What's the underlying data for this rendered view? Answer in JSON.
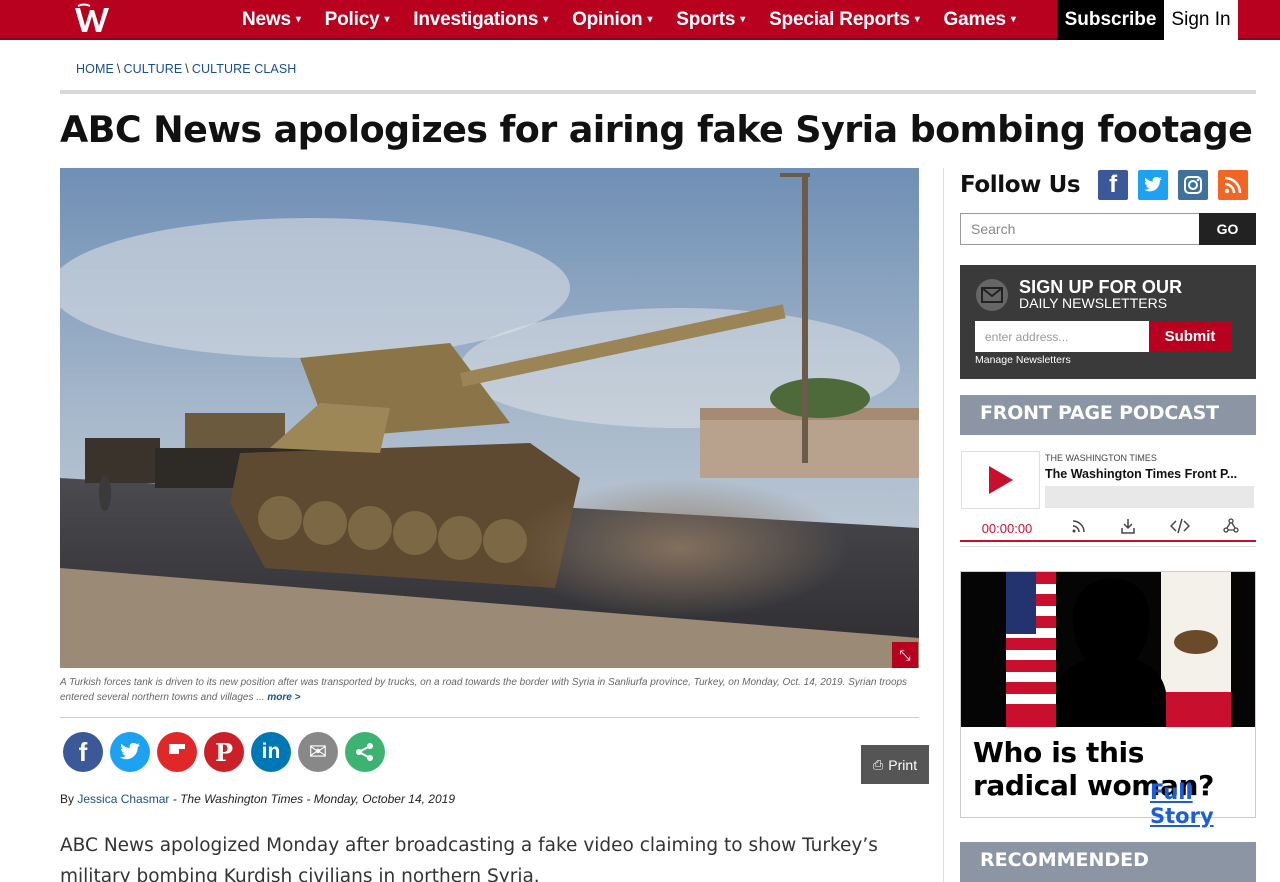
{
  "nav": {
    "logo_alt": "W",
    "items": [
      {
        "label": "News"
      },
      {
        "label": "Policy"
      },
      {
        "label": "Investigations"
      },
      {
        "label": "Opinion"
      },
      {
        "label": "Sports"
      },
      {
        "label": "Special Reports"
      },
      {
        "label": "Games"
      }
    ],
    "caret": "▾",
    "subscribe": "Subscribe",
    "signin": "Sign In"
  },
  "breadcrumb": {
    "items": [
      "HOME",
      "CULTURE",
      "CULTURE CLASH"
    ],
    "separator": "\\"
  },
  "article": {
    "headline": "ABC News apologizes for airing fake Syria bombing footage",
    "caption": "A Turkish forces tank is driven to its new position after was transported by trucks, on a road towards the border with Syria in Sanliurfa province, Turkey, on Monday, Oct. 14, 2019. Syrian troops entered several northern towns and villages ...",
    "caption_more": "more >",
    "print_label": "Print",
    "byline_prefix": "By",
    "author": "Jessica Chasmar",
    "byline_rest": "- The Washington Times - Monday, October 14, 2019",
    "body": "ABC News apologized Monday after broadcasting a fake video claiming to show Turkey’s military bombing Kurdish civilians in northern Syria."
  },
  "share": {
    "buttons": [
      {
        "name": "facebook",
        "glyph": "f",
        "color": "#3b5998"
      },
      {
        "name": "twitter",
        "glyph": "t",
        "color": "#1da1f2"
      },
      {
        "name": "flipboard",
        "glyph": "F",
        "color": "#e12828"
      },
      {
        "name": "pinterest",
        "glyph": "P",
        "color": "#cb2027"
      },
      {
        "name": "linkedin",
        "glyph": "in",
        "color": "#0077b5"
      },
      {
        "name": "email",
        "glyph": "✉",
        "color": "#888888"
      },
      {
        "name": "more",
        "glyph": "⋯",
        "color": "#3cb371"
      }
    ]
  },
  "sidebar": {
    "follow_label": "Follow Us",
    "social": [
      {
        "name": "facebook",
        "glyph": "f",
        "color": "#3b5998"
      },
      {
        "name": "twitter",
        "glyph": "t",
        "color": "#1da1f2"
      },
      {
        "name": "instagram",
        "glyph": "◎",
        "color": "#3f729b"
      },
      {
        "name": "rss",
        "glyph": "⌒",
        "color": "#f26522"
      }
    ],
    "search_placeholder": "Search",
    "search_go": "GO",
    "newsletter": {
      "title": "SIGN UP FOR OUR",
      "subtitle": "DAILY NEWSLETTERS",
      "placeholder": "enter address...",
      "submit": "Submit",
      "manage": "Manage Newsletters"
    },
    "podcast": {
      "header": "FRONT PAGE PODCAST",
      "source": "THE WASHINGTON TIMES",
      "title": "The Washington Times Front P...",
      "time": "00:00:00"
    },
    "ad": {
      "question": "Who is this radical woman?",
      "link": "Full Story"
    },
    "recommended_header": "RECOMMENDED"
  },
  "colors": {
    "brand_red": "#b8001f",
    "link_blue": "#1a4f8f",
    "sidebar_header": "#8c95a3"
  }
}
